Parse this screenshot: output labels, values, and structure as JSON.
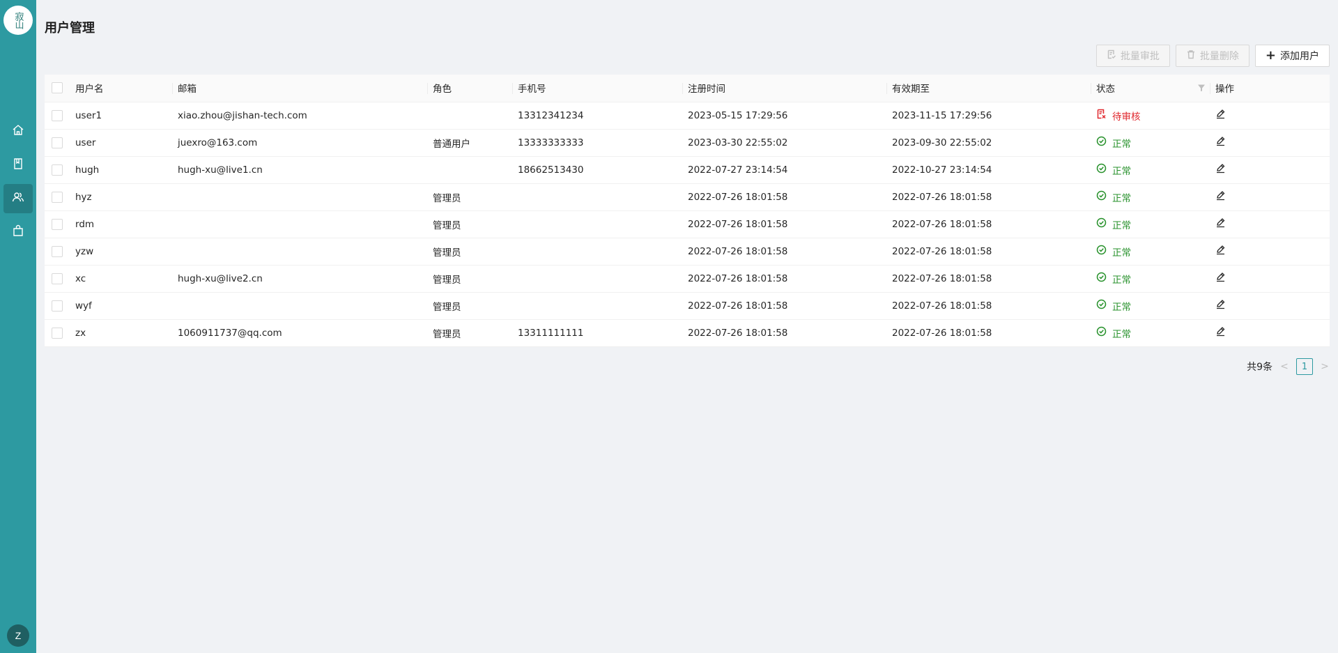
{
  "app": {
    "logo_text": "寂山",
    "avatar_initial": "Z"
  },
  "sidebar": {
    "items": [
      {
        "name": "home",
        "icon": "home-icon",
        "active": false
      },
      {
        "name": "book",
        "icon": "book-icon",
        "active": false
      },
      {
        "name": "users",
        "icon": "users-icon",
        "active": true
      },
      {
        "name": "bag",
        "icon": "bag-icon",
        "active": false
      }
    ]
  },
  "page": {
    "title": "用户管理"
  },
  "toolbar": {
    "batch_approve_label": "批量审批",
    "batch_delete_label": "批量删除",
    "add_user_label": "添加用户"
  },
  "table": {
    "columns": [
      "用户名",
      "邮箱",
      "角色",
      "手机号",
      "注册时间",
      "有效期至",
      "状态",
      "操作"
    ],
    "rows": [
      {
        "username": "user1",
        "email": "xiao.zhou@jishan-tech.com",
        "role": "",
        "phone": "13312341234",
        "registered": "2023-05-15 17:29:56",
        "valid_until": "2023-11-15 17:29:56",
        "status": "待审核",
        "status_type": "pending"
      },
      {
        "username": "user",
        "email": "juexro@163.com",
        "role": "普通用户",
        "phone": "13333333333",
        "registered": "2023-03-30 22:55:02",
        "valid_until": "2023-09-30 22:55:02",
        "status": "正常",
        "status_type": "ok"
      },
      {
        "username": "hugh",
        "email": "hugh-xu@live1.cn",
        "role": "",
        "phone": "18662513430",
        "registered": "2022-07-27 23:14:54",
        "valid_until": "2022-10-27 23:14:54",
        "status": "正常",
        "status_type": "ok"
      },
      {
        "username": "hyz",
        "email": "",
        "role": "管理员",
        "phone": "",
        "registered": "2022-07-26 18:01:58",
        "valid_until": "2022-07-26 18:01:58",
        "status": "正常",
        "status_type": "ok"
      },
      {
        "username": "rdm",
        "email": "",
        "role": "管理员",
        "phone": "",
        "registered": "2022-07-26 18:01:58",
        "valid_until": "2022-07-26 18:01:58",
        "status": "正常",
        "status_type": "ok"
      },
      {
        "username": "yzw",
        "email": "",
        "role": "管理员",
        "phone": "",
        "registered": "2022-07-26 18:01:58",
        "valid_until": "2022-07-26 18:01:58",
        "status": "正常",
        "status_type": "ok"
      },
      {
        "username": "xc",
        "email": "hugh-xu@live2.cn",
        "role": "管理员",
        "phone": "",
        "registered": "2022-07-26 18:01:58",
        "valid_until": "2022-07-26 18:01:58",
        "status": "正常",
        "status_type": "ok"
      },
      {
        "username": "wyf",
        "email": "",
        "role": "管理员",
        "phone": "",
        "registered": "2022-07-26 18:01:58",
        "valid_until": "2022-07-26 18:01:58",
        "status": "正常",
        "status_type": "ok"
      },
      {
        "username": "zx",
        "email": "1060911737@qq.com",
        "role": "管理员",
        "phone": "13311111111",
        "registered": "2022-07-26 18:01:58",
        "valid_until": "2022-07-26 18:01:58",
        "status": "正常",
        "status_type": "ok"
      }
    ]
  },
  "pagination": {
    "total_label": "共9条",
    "current_page": "1",
    "prev": "<",
    "next": ">"
  },
  "colors": {
    "sidebar": "#2d9aa1",
    "status_ok": "#27912b",
    "status_pending": "#e0282e"
  }
}
